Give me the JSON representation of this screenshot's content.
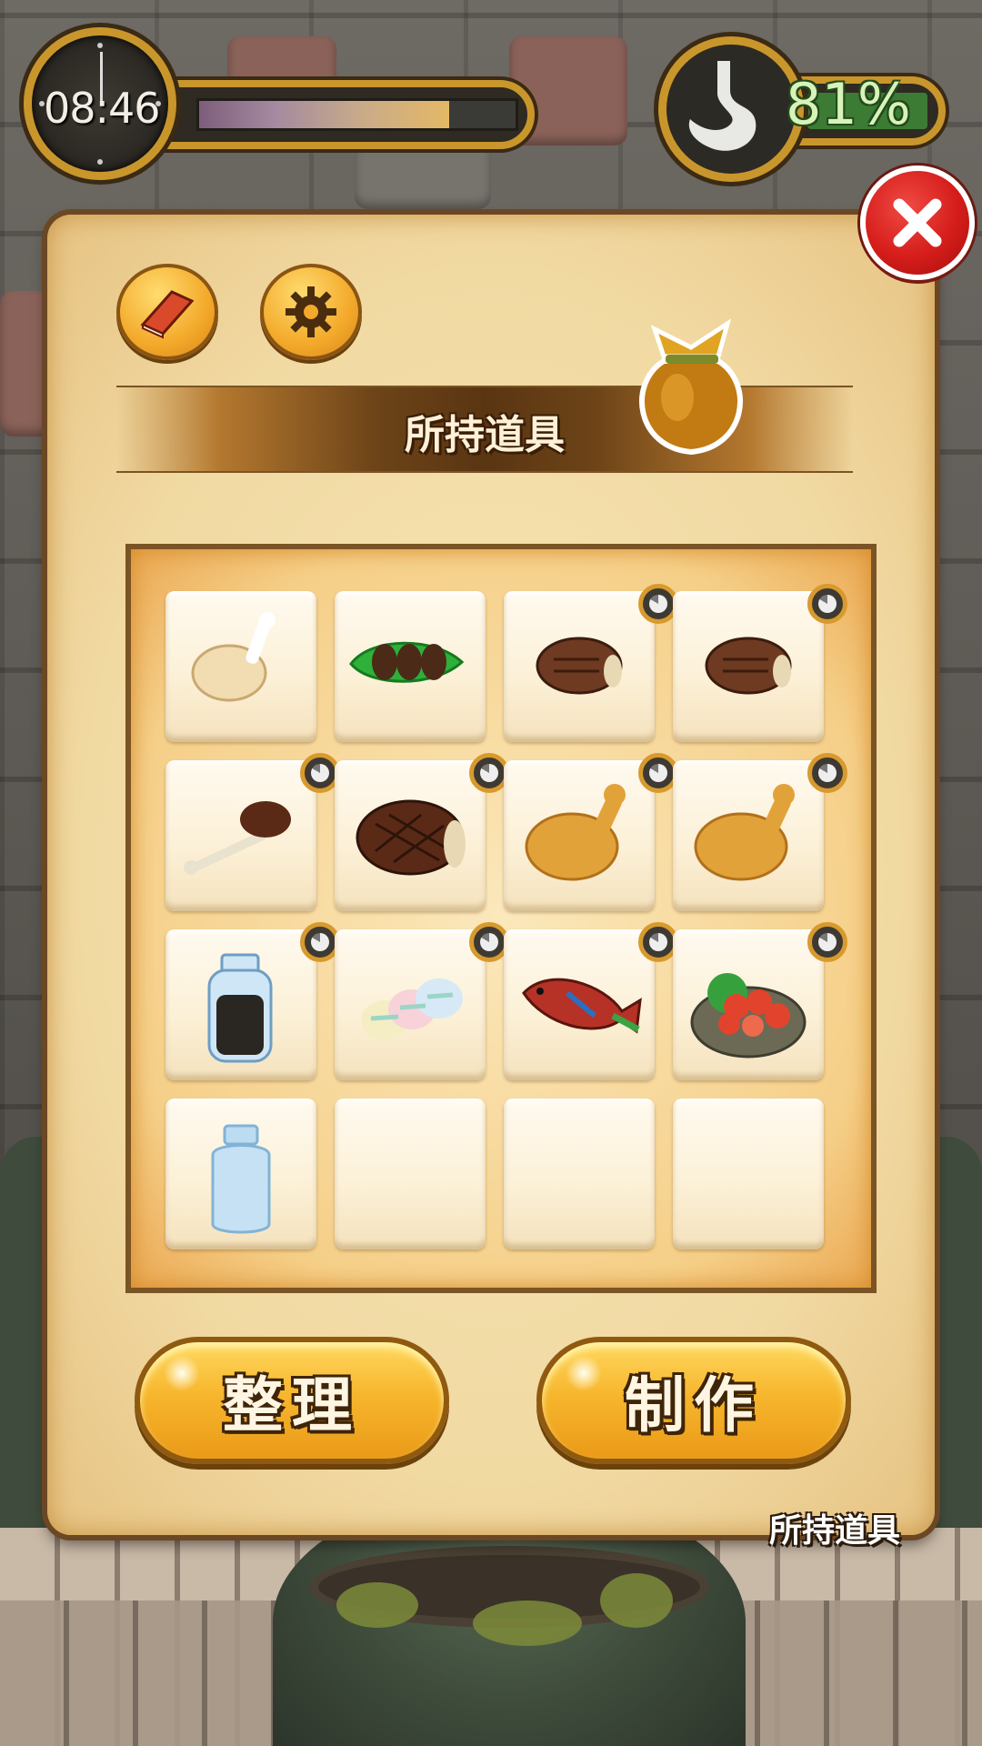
{
  "hud": {
    "clock_time": "08:46",
    "day_progress": 0.79,
    "stomach_percent": "81%",
    "stomach_level": 0.81
  },
  "panel": {
    "title": "所持道具",
    "buttons": {
      "sort_label": "整理",
      "craft_label": "制作"
    },
    "footer_label": "所持道具"
  },
  "icons": {
    "book": "book-icon",
    "settings": "gear-icon",
    "close": "close-icon",
    "bag": "item-bag-icon",
    "clock": "clock-icon",
    "stomach": "stomach-icon",
    "spoil_timer": "spoil-timer-icon"
  },
  "inventory": {
    "columns": 4,
    "slots": [
      {
        "item": "raw-drumstick",
        "timer": false
      },
      {
        "item": "cocoa-beans-on-leaf",
        "timer": false
      },
      {
        "item": "grilled-steak",
        "timer": true
      },
      {
        "item": "grilled-steak",
        "timer": true
      },
      {
        "item": "meat-on-bone",
        "timer": true
      },
      {
        "item": "large-grilled-steak",
        "timer": true
      },
      {
        "item": "fried-drumstick",
        "timer": true
      },
      {
        "item": "fried-drumstick",
        "timer": true
      },
      {
        "item": "dark-liquid-bottle",
        "timer": true
      },
      {
        "item": "rainbow-rice-cakes",
        "timer": true
      },
      {
        "item": "grilled-colorful-fish",
        "timer": true
      },
      {
        "item": "shrimp-salad-bowl",
        "timer": true
      },
      {
        "item": "empty-bottle",
        "timer": false
      },
      {
        "item": "",
        "timer": false
      },
      {
        "item": "",
        "timer": false
      },
      {
        "item": "",
        "timer": false
      }
    ]
  },
  "colors": {
    "gold_frame": "#c9962c",
    "close_red": "#d51d1a",
    "button_orange": "#f7b62d",
    "parchment": "#f1d9a2",
    "stomach_green": "#3b7b34"
  }
}
